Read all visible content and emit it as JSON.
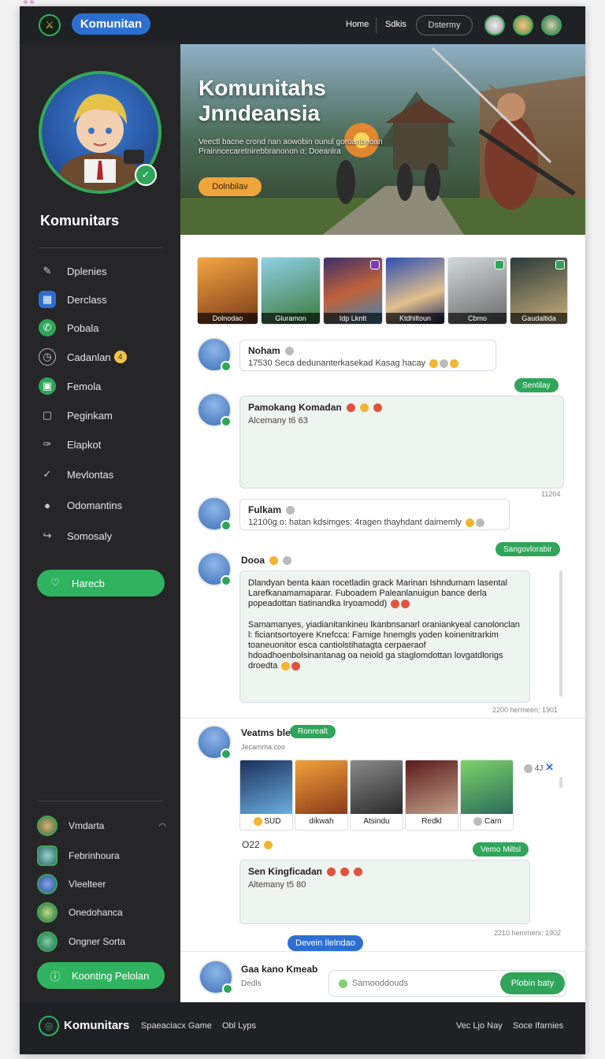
{
  "topbar": {
    "brand": "Komunitan",
    "nav": [
      "Home",
      "Sdkis"
    ],
    "nav_pill": "Dstermy"
  },
  "sidebar": {
    "profile_name": "Komunitars",
    "items": [
      {
        "label": "Dplenies",
        "icon": "pencil-icon"
      },
      {
        "label": "Derclass",
        "icon": "calendar-icon"
      },
      {
        "label": "Pobala",
        "icon": "chat-icon"
      },
      {
        "label": "Cadanlan",
        "icon": "clock-icon",
        "badge": "4"
      },
      {
        "label": "Femola",
        "icon": "grid-icon"
      },
      {
        "label": "Peginkam",
        "icon": "message-icon"
      },
      {
        "label": "Elapkot",
        "icon": "feather-icon"
      },
      {
        "label": "Mevlontas",
        "icon": "check-icon"
      },
      {
        "label": "Odomantins",
        "icon": "location-icon"
      },
      {
        "label": "Somosaly",
        "icon": "share-icon"
      }
    ],
    "primary_button": "Harecb",
    "friends": [
      {
        "name": "Vmdarta"
      },
      {
        "name": "Febrinhoura"
      },
      {
        "name": "Vleelteer"
      },
      {
        "name": "Onedohanca"
      },
      {
        "name": "Ongner Sorta"
      }
    ],
    "bottom_button": "Koonting Pelolan"
  },
  "hero": {
    "title": "Komunitahs Jnndeansia",
    "subtitle": "Veectl bacne crond nan aowobin ounul goroanbeoan Prainncecaretnirebbranonon o; Doeanlra",
    "button": "Dolnbilav"
  },
  "thumbs_top": [
    "Dolnodao",
    "Gluramon",
    "Idp Lkntt",
    "Ktdhiltoun",
    "Cbmo",
    "Gaudaltida"
  ],
  "posts": [
    {
      "name": "Noham",
      "text": "17530 Seca dedunanterkasekad Kasag hacay"
    },
    {
      "name": "Pamokang Komadan",
      "text": "Alcemany t6 63",
      "meta": "11204"
    },
    {
      "name": "Fulkam",
      "text": "12100g o: hatan kdsimges: 4ragen thayhdant daimemly"
    },
    {
      "name": "Dooa",
      "body": "Dlandyan benta kaan rocetladin grack Marinan Ishndumam lasental Larefkanamamaparar. Fuboadem Paleanlanuigun bance derla popeadottan tiatinandka Iryoamodd)",
      "body2": "Samamanyes, yiadianitankineu lkanbnsanarl oraniankyeal canolonclan l: ficiantsortoyere Knefcca: Famige hnemgls yoden koinenitrarkim toaneuonitor esca cantiolstihatagta cerpaeraof hdoadhoenbolsinantanag oa neiold ga staglomdottan lovgatdlorigs droedta",
      "meta": "2200 hermeen; 1901",
      "pill": "Sangovlorabir"
    },
    {
      "name": "Veatms ble",
      "subtitle": "Jecamma coo",
      "pill_blue_inline": "Ronrealt",
      "thumbs": [
        "SUD",
        "dikwah",
        "Atsindu",
        "Redkl",
        "Carn"
      ],
      "side_meta": "4J"
    },
    {
      "name": "Sen Kingficadan",
      "text": "Altemany t5 80",
      "meta": "2210 hemmers; 1902",
      "pill": "Vemo Miltsl",
      "pre": "O22"
    }
  ],
  "pills": {
    "sent": "Sentilay"
  },
  "composer": {
    "name": "Gaa kano Kmeab",
    "sub": "Dedls",
    "placeholder": "Samooddouds",
    "send": "Plobin baty",
    "tag": "Devein Ilelndao"
  },
  "footer": {
    "brand": "Komunitars",
    "links": [
      "Spaeaciacx Game",
      "Obl Lyps",
      "Vec Ljo Nay",
      "Soce Ifarnies"
    ]
  },
  "colors": {
    "accent_green": "#2fa55a",
    "accent_blue": "#2d6fd1",
    "dark": "#262628"
  }
}
